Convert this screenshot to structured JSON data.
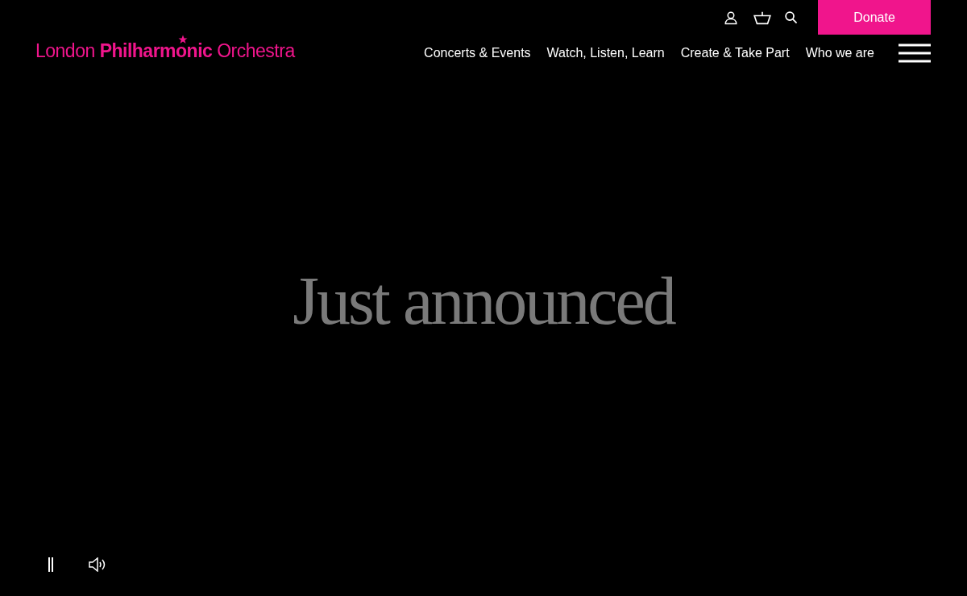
{
  "logo": {
    "text": "London **Philharmonic** Orchestra"
  },
  "utility": {
    "donate": "Donate"
  },
  "nav": [
    "Concerts & Events",
    "Watch, Listen, Learn",
    "Create & Take Part",
    "Who we are"
  ],
  "hero": {
    "title": "Just announced"
  },
  "player": {
    "paused": false,
    "muted": false
  }
}
